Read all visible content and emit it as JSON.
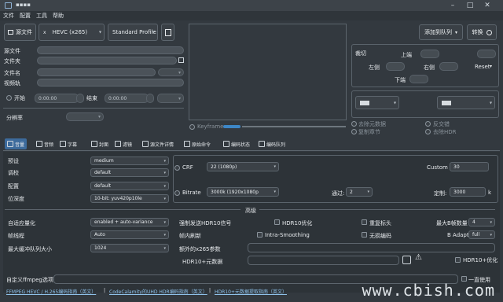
{
  "menu": [
    "文件",
    "配置",
    "工具",
    "帮助"
  ],
  "toolbar": {
    "source_button": "源文件",
    "encoder": "HEVC (x265)",
    "profile": "Standard Profile",
    "add_queue": "添加到队列",
    "convert": "转换"
  },
  "left_labels": {
    "source_file": "源文件",
    "folder": "文件夹",
    "filename": "文件名",
    "video_track": "视频轨",
    "start": "开始",
    "end": "结束",
    "resolution": "分辨率"
  },
  "time": {
    "start": "0:00:00",
    "end": "0:00:00"
  },
  "keyframe": "Keyframe",
  "crop": {
    "title": "裁切",
    "top": "上端",
    "left": "左侧",
    "right": "右侧",
    "bottom": "下端",
    "reset": "Reset"
  },
  "options": {
    "remove_metadata": "去除元数据",
    "copy_chapters": "复制章节",
    "deinterlace": "反交错",
    "remove_hdr": "去除HDR"
  },
  "tabs": [
    "音量",
    "音频",
    "字幕",
    "封面",
    "滤镜",
    "源文件详情",
    "原始命令",
    "编码状态",
    "编码队列"
  ],
  "video": {
    "preset_label": "预设",
    "preset": "medium",
    "tune_label": "调校",
    "tune": "default",
    "profile_label": "配置",
    "profile": "default",
    "bitdepth_label": "位深度",
    "bitdepth": "10-bit: yuv420p10le",
    "crf_label": "CRF",
    "crf": "22 (1080p)",
    "custom_label": "Custom",
    "custom": "30",
    "bitrate_label": "Bitrate",
    "bitrate": "3000k (1920x1080p",
    "pass_label": "通过:",
    "pass": "2",
    "fixed_label": "定制:",
    "fixed": "3000",
    "fixed_unit": "k"
  },
  "advanced": {
    "header": "高级",
    "adaptive_quant_label": "自适应量化",
    "adaptive_quant": "enabled + auto-variance",
    "force_hdr": "强制发送HDR10信号",
    "hdr10_opt": "HDR10优化",
    "repeat_headers": "重复标头",
    "max_bframes_label": "最大B帧数量",
    "max_bframes": "4",
    "frame_threads_label": "帧线程",
    "frame_threads": "Auto",
    "frame_refresh": "帧内刷新",
    "intra_smoothing": "Intra-Smoothing",
    "lossless": "无损编码",
    "badapt_label": "B Adapt",
    "badapt": "full",
    "max_lookahead_label": "最大缓冲队列大小",
    "max_lookahead": "1024",
    "extra_params_label": "额外的x265参数",
    "hdr10_metadata_label": "HDR10+元数据",
    "hdr10_plus": "HDR10+优化"
  },
  "custom_ffmpeg": "自定义ffmpeg选项",
  "always_use": "一直使用",
  "links": [
    "FFMPEG HEVC / H.265编码指南（英文）",
    "CodeCalamity的UHD HDR编码指南（英文）",
    "HDR10+元数据提取指南（英文）"
  ],
  "watermark": "www.cbish.com"
}
